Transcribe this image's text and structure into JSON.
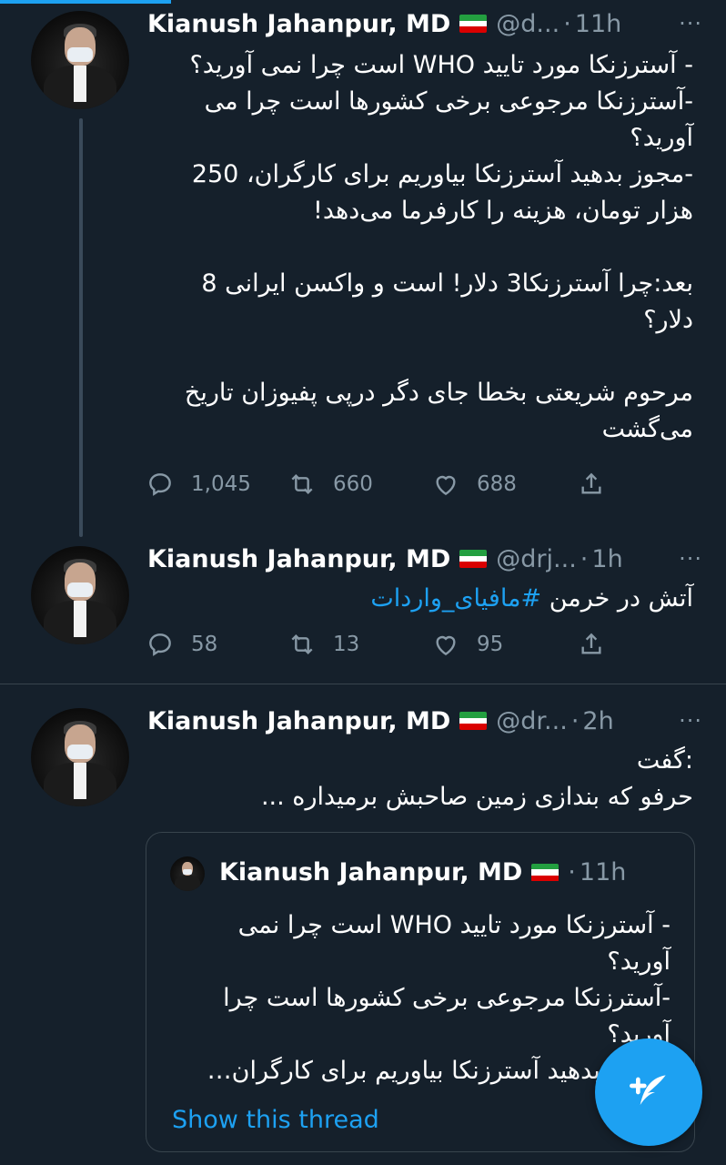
{
  "colors": {
    "background": "#15202b",
    "accent": "#1da1f2",
    "muted": "#8899a6",
    "divider": "#38444d"
  },
  "tweets": [
    {
      "name": "Kianush Jahanpur, MD",
      "flag": "🇮🇷",
      "handle": "@d...",
      "time": "11h",
      "text": "- آسترزنکا مورد تایید WHO است چرا نمی آورید؟\n-آسترزنکا مرجوعی برخی کشورها است چرا می آورید؟\n-مجوز بدهید آسترزنکا بیاوریم برای کارگران، 250 هزار تومان، هزینه را کارفرما می‌دهد!\n\nبعد:چرا آسترزنکا3 دلار! است و واکسن ایرانی 8 دلار؟\n\nمرحوم شریعتی بخطا جای دگر درپی پفیوزان تاریخ می‌گشت",
      "replies": "1,045",
      "retweets": "660",
      "likes": "688"
    },
    {
      "name": "Kianush Jahanpur, MD",
      "flag": "🇮🇷",
      "handle": "@drj...",
      "time": "1h",
      "text_plain": "آتش در خرمن ",
      "hashtag": "#مافیای_واردات",
      "replies": "58",
      "retweets": "13",
      "likes": "95"
    },
    {
      "name": "Kianush Jahanpur, MD",
      "flag": "🇮🇷",
      "handle": "@dr...",
      "time": "2h",
      "text": ":گفت\nحرفو که بندازی زمین صاحبش برمیداره ...",
      "quote": {
        "name": "Kianush Jahanpur, MD",
        "flag": "🇮🇷",
        "time": "11h",
        "text": "- آسترزنکا مورد تایید WHO است چرا نمی آورید؟\n-آسترزنکا مرجوعی برخی کشورها است چرا آورید؟\n-مجوز بدهید آسترزنکا بیاوریم برای کارگران…",
        "show_thread": "Show this thread"
      }
    }
  ],
  "more_icon": "···",
  "compose_icon": "compose-tweet-icon"
}
